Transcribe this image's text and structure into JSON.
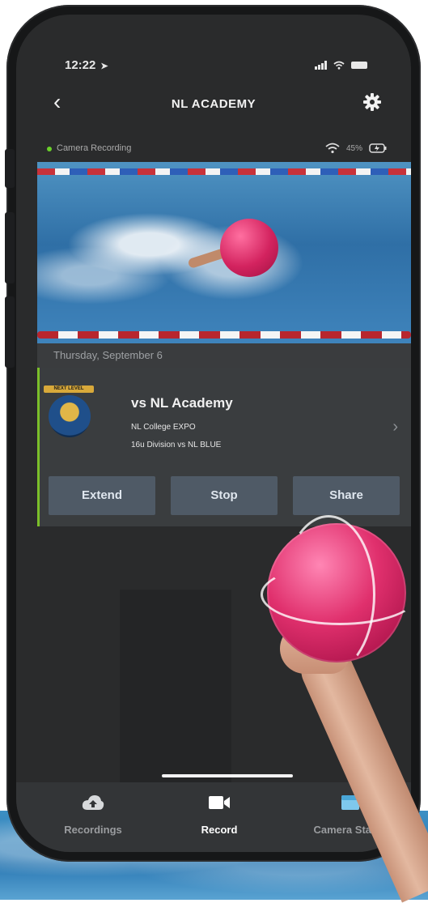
{
  "status_bar": {
    "time": "12:22",
    "location_glyph": "➤"
  },
  "nav": {
    "back_glyph": "‹",
    "title": "NL ACADEMY",
    "settings_icon": "gear-icon"
  },
  "camera": {
    "status_label": "Camera Recording",
    "battery_pct": "45%",
    "status_color": "#6ad02a"
  },
  "video": {
    "date": "Thursday, September 6"
  },
  "game": {
    "title": "vs NL Academy",
    "event": "NL College EXPO",
    "division": "16u Division vs NL BLUE",
    "logo_text": "NEXT LEVEL"
  },
  "actions": {
    "extend": "Extend",
    "stop": "Stop",
    "share": "Share"
  },
  "tabs": [
    {
      "label": "Recordings",
      "icon": "cloud-upload-icon",
      "active": false
    },
    {
      "label": "Record",
      "icon": "video-camera-icon",
      "active": true
    },
    {
      "label": "Camera Status",
      "icon": "camera-status-icon",
      "active": false
    }
  ],
  "colors": {
    "accent": "#7bbf2a",
    "button_bg": "#4f5a66",
    "screen_bg": "#2a2b2c"
  }
}
